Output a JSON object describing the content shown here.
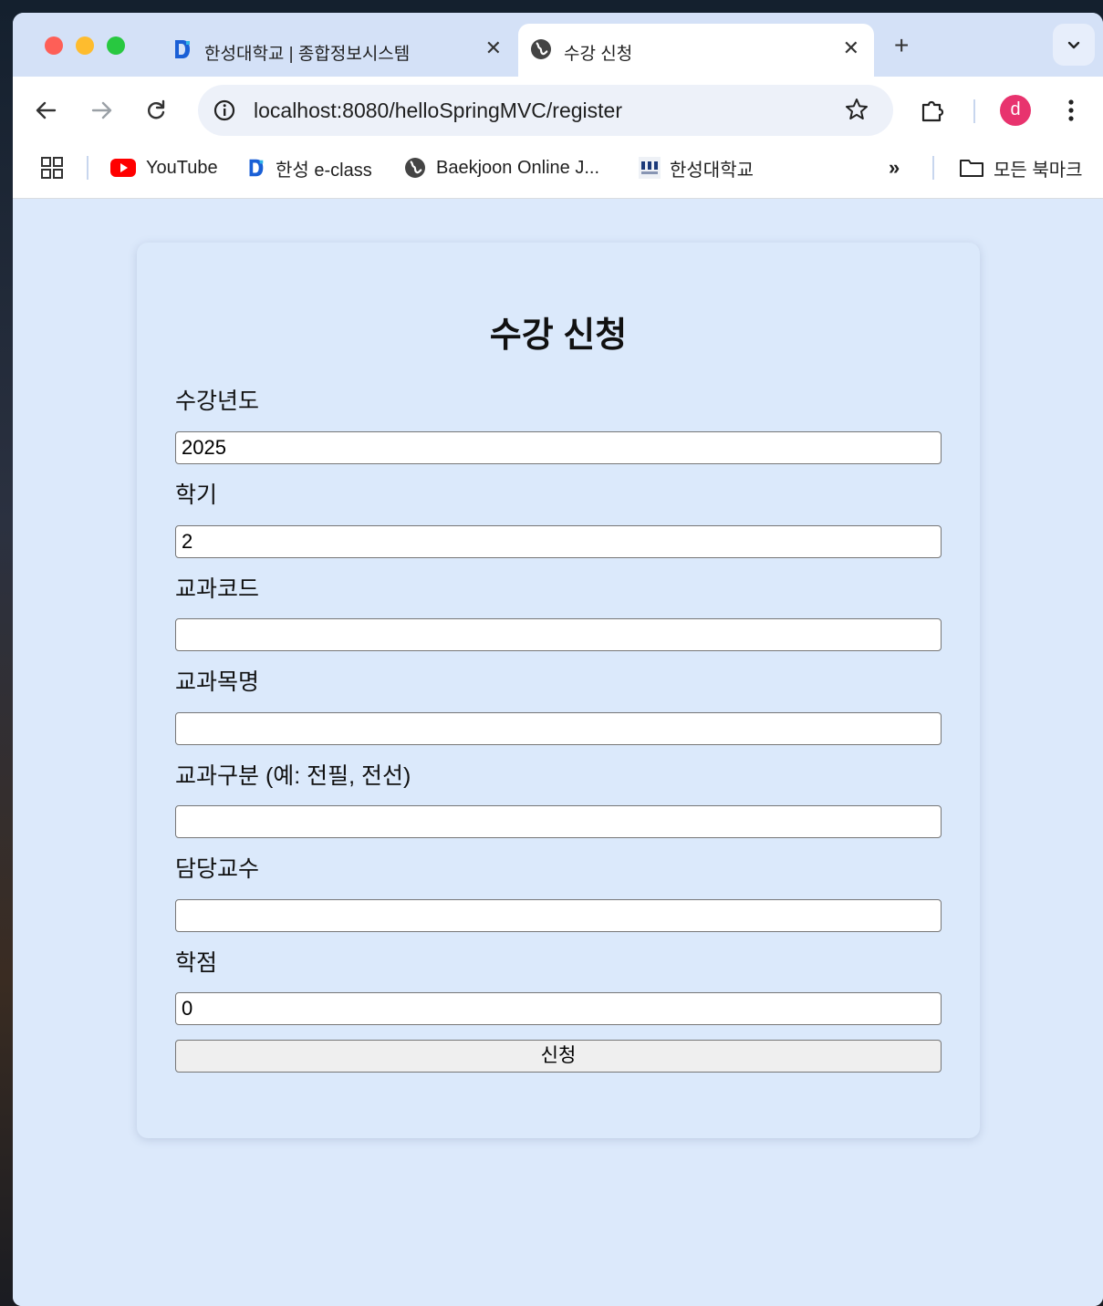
{
  "browser": {
    "tabs": [
      {
        "title": "한성대학교 | 종합정보시스템",
        "active": false,
        "close": "✕"
      },
      {
        "title": "수강 신청",
        "active": true,
        "close": "✕"
      }
    ],
    "new_tab": "+",
    "url": "localhost:8080/helloSpringMVC/register",
    "profile_initial": "d",
    "bookmarks": [
      {
        "label": "YouTube",
        "icon": "youtube-icon"
      },
      {
        "label": "한성 e-class",
        "icon": "eclass-icon"
      },
      {
        "label": "Baekjoon Online J...",
        "icon": "globe-icon"
      },
      {
        "label": "한성대학교",
        "icon": "hansung-logo-icon"
      }
    ],
    "bookmarks_overflow": "»",
    "all_bookmarks": "모든 북마크"
  },
  "form": {
    "title": "수강 신청",
    "fields": [
      {
        "label": "수강년도",
        "value": "2025"
      },
      {
        "label": "학기",
        "value": "2"
      },
      {
        "label": "교과코드",
        "value": ""
      },
      {
        "label": "교과목명",
        "value": ""
      },
      {
        "label": "교과구분 (예: 전필, 전선)",
        "value": ""
      },
      {
        "label": "담당교수",
        "value": ""
      },
      {
        "label": "학점",
        "value": "0"
      }
    ],
    "submit_label": "신청"
  },
  "colors": {
    "page_bg": "#dce9fb",
    "tab_strip": "#d4e1f7",
    "avatar": "#e8336e",
    "youtube_red": "#ff0000"
  }
}
